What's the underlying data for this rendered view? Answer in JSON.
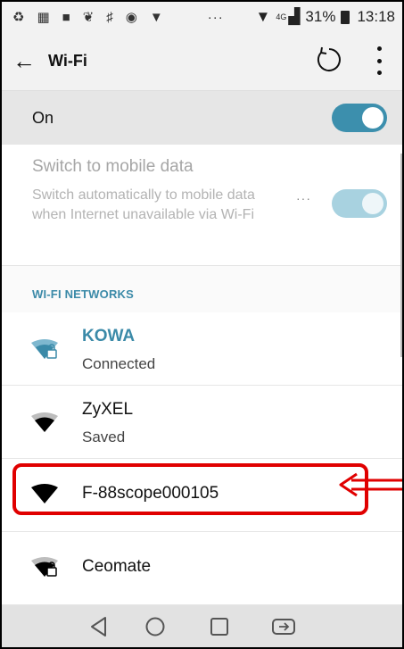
{
  "status_bar": {
    "left_icons": [
      "sync-icon",
      "calendar-icon",
      "lock-icon",
      "cat-icon",
      "hash-icon",
      "app-icon",
      "tshirt-icon"
    ],
    "more_indicator": "···",
    "network_type": "4G",
    "battery_percent": "31%",
    "time": "13:18"
  },
  "app_bar": {
    "title": "Wi-Fi"
  },
  "wifi_toggle": {
    "label": "On",
    "enabled": true
  },
  "mobile_data": {
    "title": "Switch to mobile data",
    "description": "Switch automatically to mobile data when Internet unavailable via Wi-Fi",
    "more_label": "···",
    "enabled": true
  },
  "networks": {
    "header": "WI-FI NETWORKS",
    "items": [
      {
        "ssid": "KOWA",
        "status": "Connected",
        "secured": true,
        "connected": true
      },
      {
        "ssid": "ZyXEL",
        "status": "Saved",
        "secured": false,
        "connected": false
      },
      {
        "ssid": "F-88scope000105",
        "status": "",
        "secured": false,
        "connected": false
      },
      {
        "ssid": "Ceomate",
        "status": "",
        "secured": true,
        "connected": false
      }
    ]
  },
  "colors": {
    "accent": "#3b8aa8",
    "toggle_on": "#3c8fad",
    "annotation": "#e00000"
  },
  "nav_bar": {
    "buttons": [
      "back-icon",
      "home-icon",
      "recents-icon",
      "dual-window-icon"
    ]
  }
}
